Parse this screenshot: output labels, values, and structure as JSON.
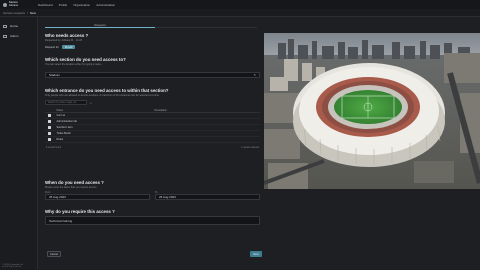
{
  "app": {
    "brand": [
      "Secure",
      "Access"
    ],
    "nav": [
      "Dashboard",
      "Profile",
      "Organisation",
      "Administration"
    ]
  },
  "breadcrumb": {
    "parent": "Access requests",
    "separator": "/",
    "current": "New"
  },
  "sidebar": {
    "items": [
      {
        "label": "Home",
        "icon": "home-icon"
      },
      {
        "label": "Admin",
        "icon": "admin-icon"
      }
    ],
    "footer": [
      "© 2024 Company Ltd",
      "v1.0.0    Terms of use"
    ]
  },
  "tabs": {
    "active": "Request"
  },
  "who": {
    "title": "Who needs access ?",
    "subtitle": "Requested by: Adriana M. · 11:23",
    "requestor_label": "Request for",
    "requestor_chip": "Myself"
  },
  "section": {
    "title": "Which section do you need access to?",
    "subtitle": "You can select the location either by typing a name",
    "value": "Stadium"
  },
  "entrance": {
    "title": "Which entrance do you need access to within that section?",
    "subtitle": "Only people who are allowed to access sections. A maximum of 10 entrances can be selected at a time.",
    "search_placeholder": "Search by name / tags, etc",
    "columns": {
      "name": "Name",
      "description": "Description"
    },
    "rows": [
      {
        "name": "Car Lot"
      },
      {
        "name": "Administration lab"
      },
      {
        "name": "Southern tiers"
      },
      {
        "name": "Ticket Booth"
      },
      {
        "name": "Roles"
      }
    ],
    "footer_left": "5 results found",
    "footer_right": "1 results selected"
  },
  "when": {
    "title": "When do you need access ?",
    "subtitle": "Please enter the dates that you require access",
    "from_label": "From",
    "from_value": "25 Aug 2023",
    "to_label": "To",
    "to_value": "26 Aug 2023"
  },
  "why": {
    "title": "Why do you require this access ?",
    "value": "Technical training"
  },
  "actions": {
    "cancel": "Cancel",
    "next": "Next"
  },
  "colors": {
    "accent": "#6fb3c9",
    "background": "#1e1f22",
    "next_button": "#3d7f8f"
  }
}
